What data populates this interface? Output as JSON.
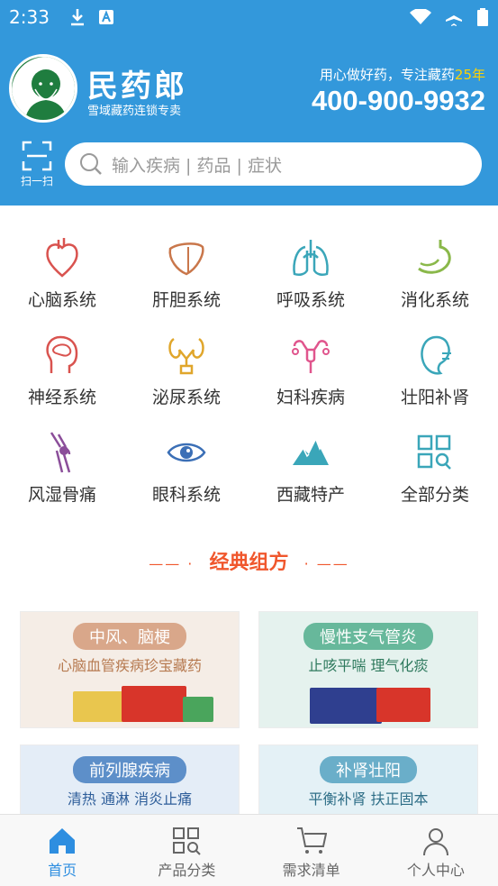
{
  "status_bar": {
    "time": "2:33"
  },
  "header": {
    "brand_name": "民药郎",
    "brand_sub": "雪域藏药连锁专卖",
    "slogan": "用心做好药，专注藏药",
    "slogan_years": "25年",
    "hotline": "400-900-9932",
    "scan_label": "扫一扫",
    "search_placeholder": "输入疾病 | 药品 | 症状"
  },
  "categories": [
    {
      "label": "心脑系统",
      "icon": "heart-icon"
    },
    {
      "label": "肝胆系统",
      "icon": "liver-icon"
    },
    {
      "label": "呼吸系统",
      "icon": "lungs-icon"
    },
    {
      "label": "消化系统",
      "icon": "stomach-icon"
    },
    {
      "label": "神经系统",
      "icon": "brain-head-icon"
    },
    {
      "label": "泌尿系统",
      "icon": "kidneys-icon"
    },
    {
      "label": "妇科疾病",
      "icon": "uterus-icon"
    },
    {
      "label": "壮阳补肾",
      "icon": "kidney-icon"
    },
    {
      "label": "风湿骨痛",
      "icon": "knee-joint-icon"
    },
    {
      "label": "眼科系统",
      "icon": "eye-icon"
    },
    {
      "label": "西藏特产",
      "icon": "mountain-icon"
    },
    {
      "label": "全部分类",
      "icon": "grid-search-icon"
    }
  ],
  "section": {
    "title": "经典组方",
    "dash_left": "—— ·",
    "dash_right": "· ——"
  },
  "banners": [
    {
      "title": "中风、脑梗",
      "subtitle": "心脑血管疾病珍宝藏药",
      "pill_color": "#d9a78a",
      "sub_color": "#b6794f",
      "bg": "#f5ede6"
    },
    {
      "title": "慢性支气管炎",
      "subtitle": "止咳平喘  理气化痰",
      "pill_color": "#67b89b",
      "sub_color": "#2f7a5e",
      "bg": "#e5f2ee"
    },
    {
      "title": "前列腺疾病",
      "subtitle": "清热 通淋 消炎止痛",
      "pill_color": "#5d8fc9",
      "sub_color": "#2e5e9a",
      "bg": "#e4edf7"
    },
    {
      "title": "补肾壮阳",
      "subtitle": "平衡补肾 扶正固本",
      "pill_color": "#6aaec9",
      "sub_color": "#2e6e87",
      "bg": "#e4f1f6"
    }
  ],
  "bottom_nav": [
    {
      "label": "首页",
      "icon": "home-icon",
      "active": true
    },
    {
      "label": "产品分类",
      "icon": "category-search-icon",
      "active": false
    },
    {
      "label": "需求清单",
      "icon": "cart-icon",
      "active": false
    },
    {
      "label": "个人中心",
      "icon": "person-icon",
      "active": false
    }
  ],
  "colors": {
    "primary": "#3398db",
    "accent": "#f0572d",
    "nav_active": "#2e8ee0"
  }
}
